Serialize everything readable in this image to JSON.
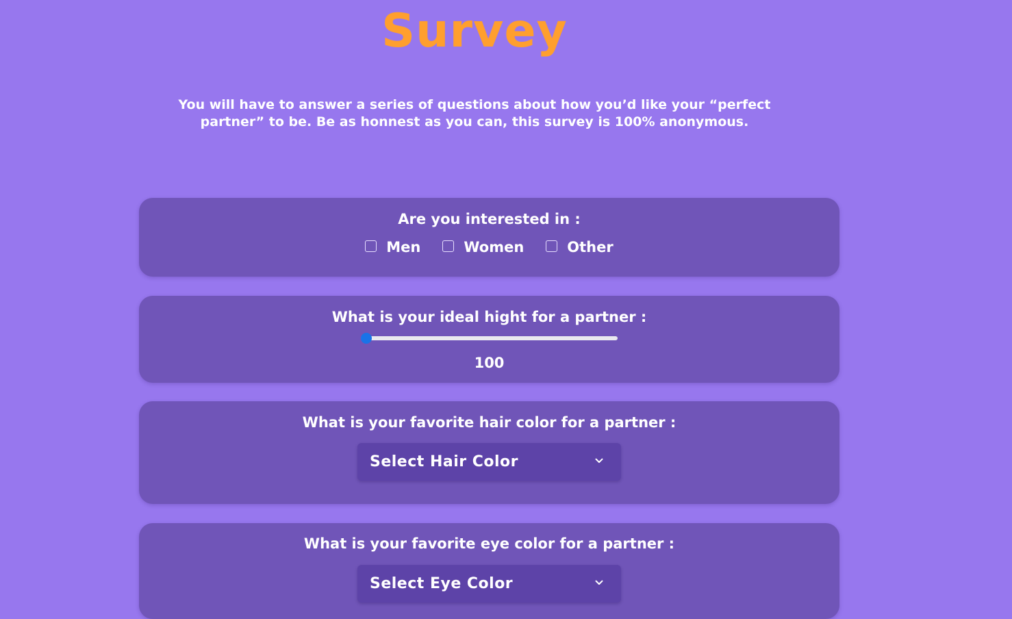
{
  "header": {
    "title": "Survey",
    "intro_line1": "You will have to answer a series of questions about how you’d like your “perfect",
    "intro_line2": "partner” to be. Be as honnest as you can, this survey is 100% anonymous."
  },
  "questions": {
    "interest": {
      "label": "Are you interested in :",
      "options": [
        "Men",
        "Women",
        "Other"
      ],
      "checked": [
        false,
        false,
        false
      ]
    },
    "height": {
      "label": "What is your ideal hight for a partner :",
      "value": "100",
      "slider_fraction": 0
    },
    "hair": {
      "label": "What is your favorite hair color for a partner :",
      "selected": "Select Hair Color"
    },
    "eye": {
      "label": "What is your favorite eye color for a partner :",
      "selected": "Select Eye Color"
    }
  },
  "icons": {
    "dropdown": "chevron-down-icon"
  },
  "colors": {
    "background": "#9777ee",
    "card": "#7055b8",
    "title": "#ff9f2e",
    "select": "#5d43a8",
    "slider_thumb": "#1a73e8"
  }
}
